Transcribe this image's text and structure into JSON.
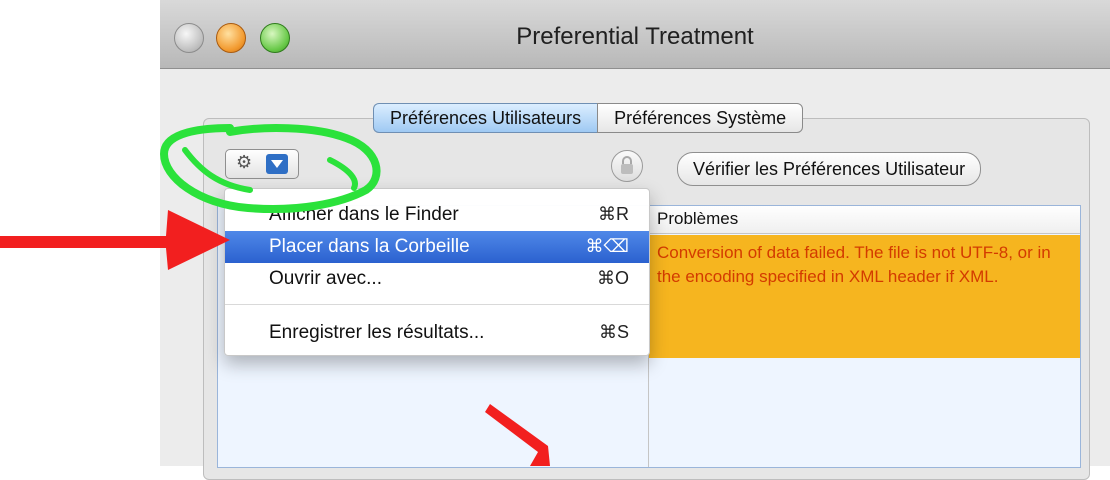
{
  "window": {
    "title": "Preferential Treatment"
  },
  "tabs": {
    "user_prefs": "Préférences Utilisateurs",
    "system_prefs": "Préférences Système"
  },
  "toolbar": {
    "action_icon": "gear-icon",
    "dropdown_icon": "triangle-down-icon",
    "lock_icon": "lock-icon",
    "verify_label": "Vérifier les Préférences Utilisateur"
  },
  "context_menu": {
    "items": [
      {
        "label": "Afficher dans le Finder",
        "shortcut": "⌘R",
        "selected": false
      },
      {
        "label": "Placer dans la Corbeille",
        "shortcut": "⌘⌫",
        "selected": true
      },
      {
        "label": "Ouvrir avec...",
        "shortcut": "⌘O",
        "selected": false
      },
      {
        "label": "Enregistrer les résultats...",
        "shortcut": "⌘S",
        "selected": false
      }
    ]
  },
  "table": {
    "problems_header": "Problèmes",
    "problem_text": "Conversion of data failed. The file is not UTF-8, or in the encoding specified in XML header if XML."
  },
  "colors": {
    "accent_blue": "#2B61CF",
    "problem_bg": "#F6B51F",
    "problem_text": "#D33B00",
    "annotation_green": "#2BE23B",
    "annotation_red": "#F21F1F"
  }
}
